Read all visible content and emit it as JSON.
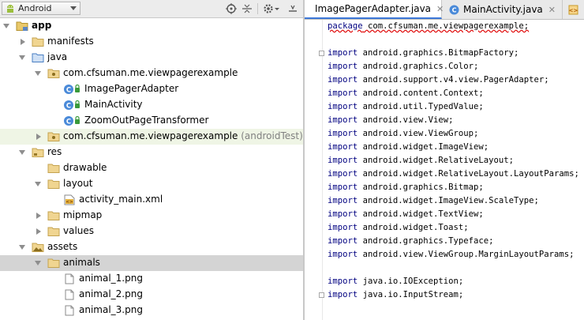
{
  "project_panel": {
    "selector_label": "Android",
    "icons": [
      "android-icon",
      "target-icon",
      "collapse-all-icon",
      "gear-icon",
      "hide-panel-icon"
    ]
  },
  "tree": [
    {
      "label": "app",
      "bold": true,
      "icon": "module-folder-icon",
      "expanded": true,
      "indent": 0
    },
    {
      "label": "manifests",
      "icon": "folder-icon",
      "expanded": false,
      "indent": 1
    },
    {
      "label": "java",
      "icon": "source-folder-icon",
      "expanded": true,
      "indent": 1
    },
    {
      "label": "com.cfsuman.me.viewpagerexample",
      "icon": "package-icon",
      "expanded": true,
      "indent": 2
    },
    {
      "label": "ImagePagerAdapter",
      "icon": "class-icon",
      "indent": 3
    },
    {
      "label": "MainActivity",
      "icon": "class-icon",
      "indent": 3
    },
    {
      "label": "ZoomOutPageTransformer",
      "icon": "class-icon",
      "indent": 3
    },
    {
      "label": "com.cfsuman.me.viewpagerexample",
      "suffix": " (androidTest)",
      "icon": "package-icon",
      "expanded": false,
      "indent": 2,
      "highlight": "green"
    },
    {
      "label": "res",
      "icon": "resource-folder-icon",
      "expanded": true,
      "indent": 1
    },
    {
      "label": "drawable",
      "icon": "folder-icon",
      "indent": 2
    },
    {
      "label": "layout",
      "icon": "folder-icon",
      "expanded": true,
      "indent": 2
    },
    {
      "label": "activity_main.xml",
      "icon": "xml-file-icon",
      "indent": 3
    },
    {
      "label": "mipmap",
      "icon": "folder-icon",
      "expanded": false,
      "indent": 2
    },
    {
      "label": "values",
      "icon": "folder-icon",
      "expanded": false,
      "indent": 2
    },
    {
      "label": "assets",
      "icon": "assets-folder-icon",
      "expanded": true,
      "indent": 1
    },
    {
      "label": "animals",
      "icon": "folder-icon",
      "expanded": true,
      "indent": 2,
      "highlight": "selected"
    },
    {
      "label": "animal_1.png",
      "icon": "image-file-icon",
      "indent": 3
    },
    {
      "label": "animal_2.png",
      "icon": "image-file-icon",
      "indent": 3
    },
    {
      "label": "animal_3.png",
      "icon": "image-file-icon",
      "indent": 3
    }
  ],
  "editor": {
    "tabs": [
      {
        "label": "ImagePagerAdapter.java",
        "active": true
      },
      {
        "label": "MainActivity.java",
        "active": false
      }
    ],
    "code_lines": [
      "package com.cfsuman.me.viewpagerexample;",
      "",
      "import android.graphics.BitmapFactory;",
      "import android.graphics.Color;",
      "import android.support.v4.view.PagerAdapter;",
      "import android.content.Context;",
      "import android.util.TypedValue;",
      "import android.view.View;",
      "import android.view.ViewGroup;",
      "import android.widget.ImageView;",
      "import android.widget.RelativeLayout;",
      "import android.widget.RelativeLayout.LayoutParams;",
      "import android.graphics.Bitmap;",
      "import android.widget.ImageView.ScaleType;",
      "import android.widget.TextView;",
      "import android.widget.Toast;",
      "import android.graphics.Typeface;",
      "import android.view.ViewGroup.MarginLayoutParams;",
      "",
      "import java.io.IOException;",
      "import java.io.InputStream;"
    ]
  },
  "colors": {
    "keyword": "#000080",
    "selection": "#d4d4d4",
    "test_highlight": "#eff5e5",
    "tab_underline": "#3c78d8"
  }
}
